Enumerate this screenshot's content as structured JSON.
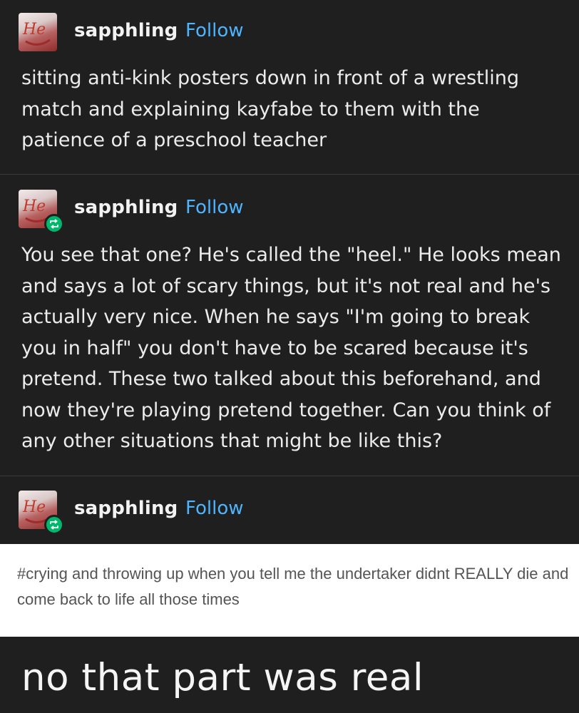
{
  "posts": [
    {
      "username": "sapphling",
      "follow_label": "Follow",
      "avatar_icon": "avatar-image",
      "reblogged": false,
      "text": "sitting anti-kink posters down in front of a wrestling match and explaining kayfabe to them with the patience of a preschool teacher"
    },
    {
      "username": "sapphling",
      "follow_label": "Follow",
      "avatar_icon": "avatar-image",
      "reblogged": true,
      "text": "You see that one? He's called the \"heel.\" He looks mean and says a lot of scary things, but it's not real and he's actually very nice. When he says \"I'm going to break you in half\" you don't have to be scared because it's pretend. These two talked about this beforehand, and now they're playing pretend together. Can you think of any other situations that might be like this?"
    },
    {
      "username": "sapphling",
      "follow_label": "Follow",
      "avatar_icon": "avatar-image",
      "reblogged": true
    }
  ],
  "tag_screenshot": {
    "text": "#crying and throwing up when you tell me the undertaker didnt REALLY die and come back to life all those times"
  },
  "caption": "no that part was real",
  "colors": {
    "background": "#1f1f1f",
    "follow": "#4db4ff",
    "reblog_badge": "#00b86b"
  }
}
